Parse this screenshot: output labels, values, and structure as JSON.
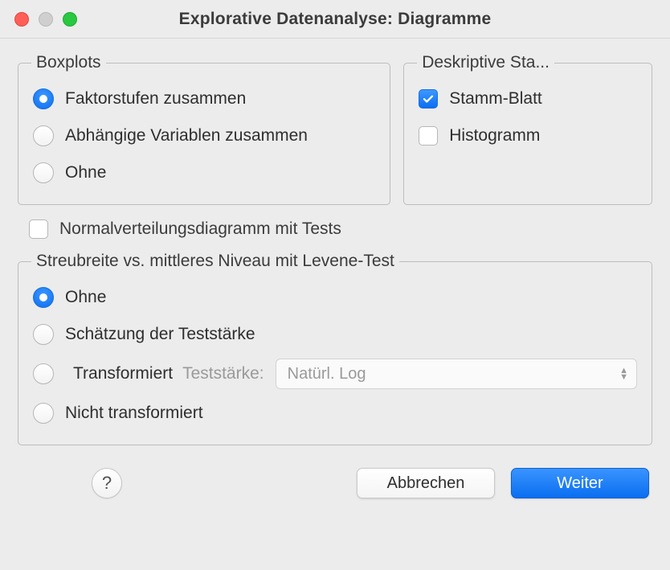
{
  "window": {
    "title": "Explorative Datenanalyse: Diagramme"
  },
  "boxplots": {
    "legend": "Boxplots",
    "options": {
      "together": "Faktorstufen zusammen",
      "dependent": "Abhängige Variablen zusammen",
      "none": "Ohne"
    }
  },
  "descriptive": {
    "legend": "Deskriptive Sta...",
    "stem_leaf": "Stamm-Blatt",
    "histogram": "Histogramm"
  },
  "normality": {
    "label": "Normalverteilungsdiagramm mit Tests"
  },
  "spread": {
    "legend": "Streubreite vs. mittleres Niveau mit Levene-Test",
    "options": {
      "none": "Ohne",
      "power": "Schätzung der Teststärke",
      "transformed": "Transformiert",
      "untransformed": "Nicht transformiert"
    },
    "test_strength_label": "Teststärke:",
    "transform_selected": "Natürl. Log"
  },
  "footer": {
    "help": "?",
    "cancel": "Abbrechen",
    "continue": "Weiter"
  }
}
